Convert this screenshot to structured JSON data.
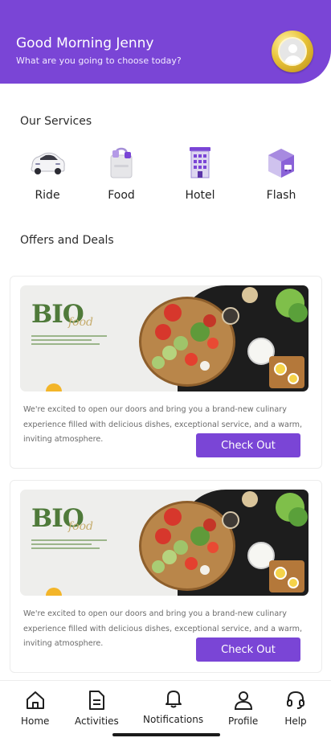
{
  "header": {
    "greeting": "Good Morning Jenny",
    "subtitle": "What are you going to choose today?",
    "avatar_icon": "user-avatar-icon"
  },
  "services": {
    "title": "Our Services",
    "items": [
      {
        "label": "Ride",
        "icon": "car-icon"
      },
      {
        "label": "Food",
        "icon": "shopping-bag-icon"
      },
      {
        "label": "Hotel",
        "icon": "hotel-building-icon"
      },
      {
        "label": "Flash",
        "icon": "delivery-box-icon"
      }
    ]
  },
  "offers": {
    "title": "Offers and Deals",
    "cards": [
      {
        "banner_brand": "BIO",
        "banner_script": "food",
        "description": "We're excited to open our doors and bring you a brand-new culinary experience filled with delicious dishes, exceptional service, and a warm, inviting atmosphere.",
        "button_label": "Check Out"
      },
      {
        "banner_brand": "BIO",
        "banner_script": "food",
        "description": "We're excited to open our doors and bring you a brand-new culinary experience filled with delicious dishes, exceptional service, and a warm, inviting atmosphere.",
        "button_label": "Check Out"
      }
    ]
  },
  "bottom_nav": {
    "items": [
      {
        "label": "Home",
        "icon": "home-icon"
      },
      {
        "label": "Activities",
        "icon": "document-icon"
      },
      {
        "label": "Notifications",
        "icon": "bell-icon"
      },
      {
        "label": "Profile",
        "icon": "person-icon"
      },
      {
        "label": "Help",
        "icon": "headset-icon"
      }
    ]
  },
  "colors": {
    "accent": "#7a45d6",
    "header_bg": "#7a45d6",
    "text_primary": "#2b2b2b"
  }
}
